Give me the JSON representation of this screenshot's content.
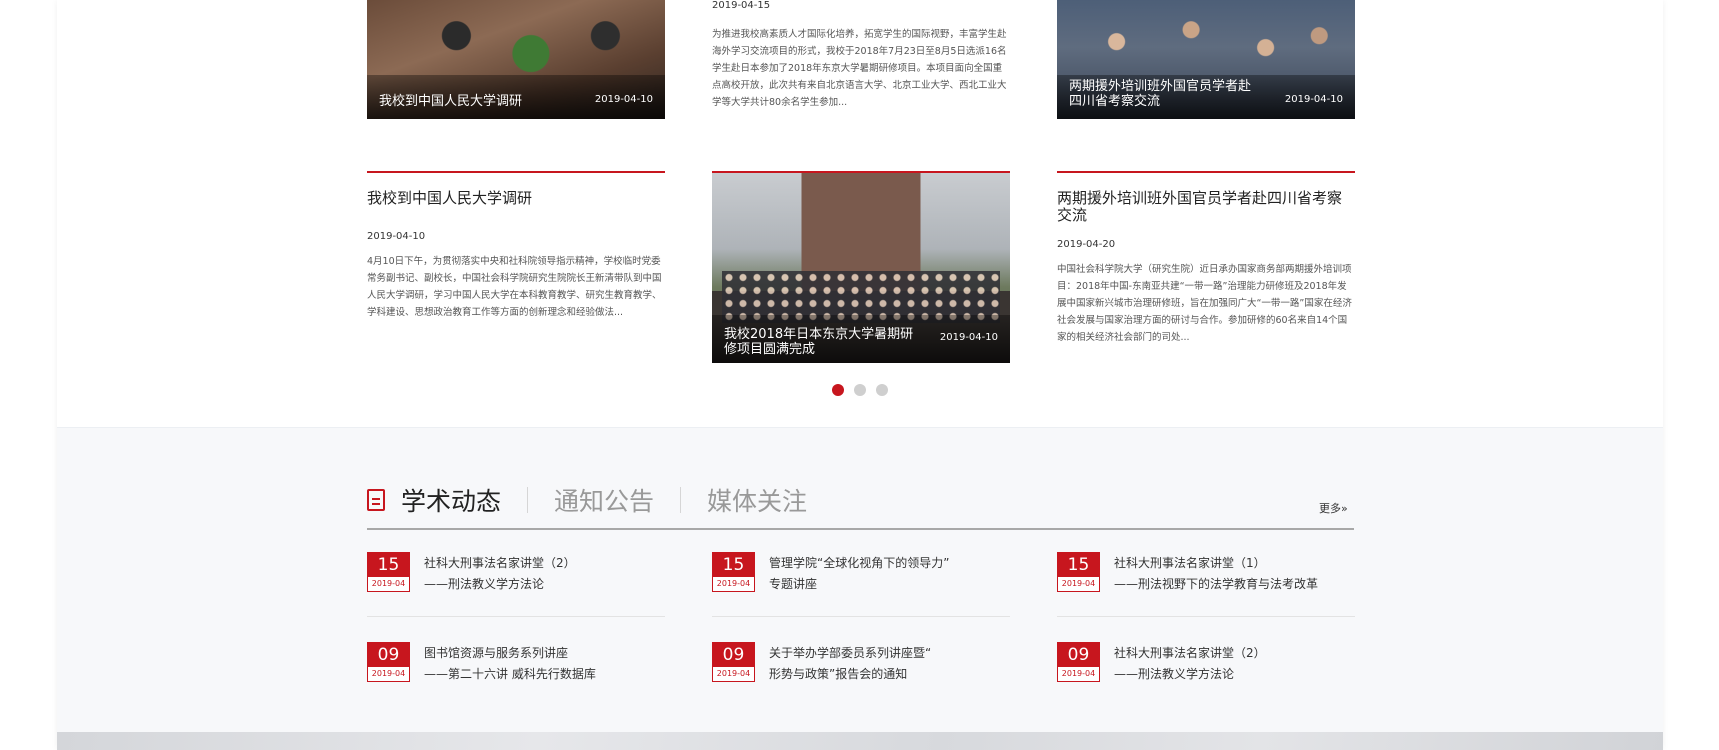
{
  "news": {
    "row1": {
      "card1": {
        "caption": "我校到中国人民大学调研",
        "date": "2019-04-10"
      },
      "card2": {
        "date": "2019-04-15",
        "body": "为推进我校高素质人才国际化培养，拓宽学生的国际视野，丰富学生赴海外学习交流项目的形式，我校于2018年7月23日至8月5日选派16名学生赴日本参加了2018年东京大学暑期研修项目。本项目面向全国重点高校开放，此次共有来自北京语言大学、北京工业大学、西北工业大学等大学共计80余名学生参加..."
      },
      "card3": {
        "caption": "两期援外培训班外国官员学者赴四川省考察交流",
        "date": "2019-04-10"
      }
    },
    "row2": {
      "card1": {
        "title": "我校到中国人民大学调研",
        "date": "2019-04-10",
        "body": "4月10日下午，为贯彻落实中央和社科院领导指示精神，学校临时党委常务副书记、副校长，中国社会科学院研究生院院长王新清带队到中国人民大学调研，学习中国人民大学在本科教育教学、研究生教育教学、学科建设、思想政治教育工作等方面的创新理念和经验做法..."
      },
      "card2": {
        "caption": "我校2018年日本东京大学暑期研修项目圆满完成",
        "date": "2019-04-10"
      },
      "card3": {
        "title": "两期援外培训班外国官员学者赴四川省考察交流",
        "date": "2019-04-20",
        "body": "中国社会科学院大学（研究生院）近日承办国家商务部两期援外培训项目：2018年中国-东南亚共建“一带一路”治理能力研修班及2018年发展中国家新兴城市治理研修班，旨在加强同广大“一带一路”国家在经济社会发展与国家治理方面的研讨与合作。参加研修的60名来自14个国家的相关经济社会部门的司处..."
      }
    }
  },
  "tabs": {
    "items": [
      "学术动态",
      "通知公告",
      "媒体关注"
    ],
    "active_index": 0,
    "more": "更多»"
  },
  "events": [
    {
      "day": "15",
      "month": "2019-04",
      "line1": "社科大刑事法名家讲堂（2）",
      "line2": "——刑法教义学方法论"
    },
    {
      "day": "15",
      "month": "2019-04",
      "line1": "管理学院“全球化视角下的领导力”",
      "line2": "专题讲座"
    },
    {
      "day": "15",
      "month": "2019-04",
      "line1": "社科大刑事法名家讲堂（1）",
      "line2": "——刑法视野下的法学教育与法考改革"
    },
    {
      "day": "09",
      "month": "2019-04",
      "line1": "图书馆资源与服务系列讲座",
      "line2": "——第二十六讲 威科先行数据库"
    },
    {
      "day": "09",
      "month": "2019-04",
      "line1": "关于举办学部委员系列讲座暨“",
      "line2": "形势与政策”报告会的通知"
    },
    {
      "day": "09",
      "month": "2019-04",
      "line1": "社科大刑事法名家讲堂（2）",
      "line2": "——刑法教义学方法论"
    }
  ],
  "pagination": {
    "count": 3,
    "active_index": 0
  },
  "colors": {
    "accent": "#c7161e",
    "bg_lower": "#f7f8fa"
  }
}
